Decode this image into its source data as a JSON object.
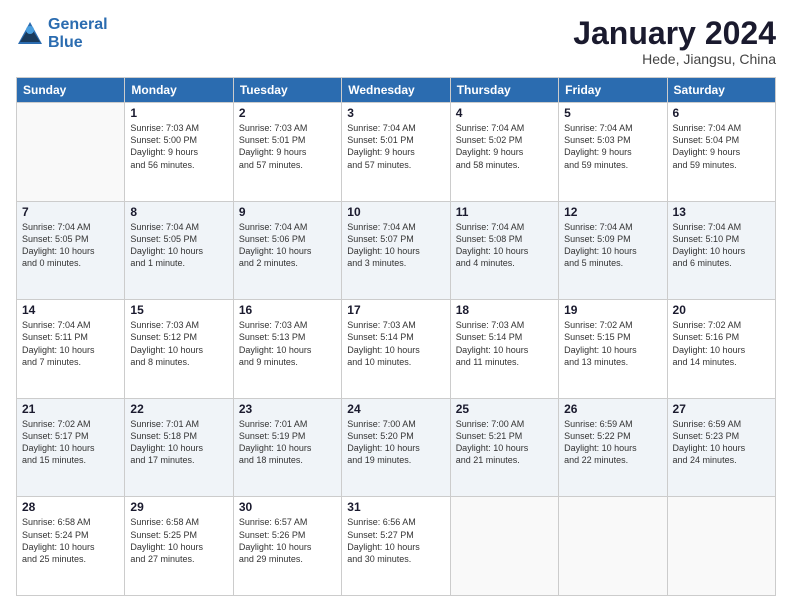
{
  "logo": {
    "line1": "General",
    "line2": "Blue"
  },
  "title": "January 2024",
  "location": "Hede, Jiangsu, China",
  "weekdays": [
    "Sunday",
    "Monday",
    "Tuesday",
    "Wednesday",
    "Thursday",
    "Friday",
    "Saturday"
  ],
  "weeks": [
    [
      {
        "day": "",
        "info": ""
      },
      {
        "day": "1",
        "info": "Sunrise: 7:03 AM\nSunset: 5:00 PM\nDaylight: 9 hours\nand 56 minutes."
      },
      {
        "day": "2",
        "info": "Sunrise: 7:03 AM\nSunset: 5:01 PM\nDaylight: 9 hours\nand 57 minutes."
      },
      {
        "day": "3",
        "info": "Sunrise: 7:04 AM\nSunset: 5:01 PM\nDaylight: 9 hours\nand 57 minutes."
      },
      {
        "day": "4",
        "info": "Sunrise: 7:04 AM\nSunset: 5:02 PM\nDaylight: 9 hours\nand 58 minutes."
      },
      {
        "day": "5",
        "info": "Sunrise: 7:04 AM\nSunset: 5:03 PM\nDaylight: 9 hours\nand 59 minutes."
      },
      {
        "day": "6",
        "info": "Sunrise: 7:04 AM\nSunset: 5:04 PM\nDaylight: 9 hours\nand 59 minutes."
      }
    ],
    [
      {
        "day": "7",
        "info": "Sunrise: 7:04 AM\nSunset: 5:05 PM\nDaylight: 10 hours\nand 0 minutes."
      },
      {
        "day": "8",
        "info": "Sunrise: 7:04 AM\nSunset: 5:05 PM\nDaylight: 10 hours\nand 1 minute."
      },
      {
        "day": "9",
        "info": "Sunrise: 7:04 AM\nSunset: 5:06 PM\nDaylight: 10 hours\nand 2 minutes."
      },
      {
        "day": "10",
        "info": "Sunrise: 7:04 AM\nSunset: 5:07 PM\nDaylight: 10 hours\nand 3 minutes."
      },
      {
        "day": "11",
        "info": "Sunrise: 7:04 AM\nSunset: 5:08 PM\nDaylight: 10 hours\nand 4 minutes."
      },
      {
        "day": "12",
        "info": "Sunrise: 7:04 AM\nSunset: 5:09 PM\nDaylight: 10 hours\nand 5 minutes."
      },
      {
        "day": "13",
        "info": "Sunrise: 7:04 AM\nSunset: 5:10 PM\nDaylight: 10 hours\nand 6 minutes."
      }
    ],
    [
      {
        "day": "14",
        "info": "Sunrise: 7:04 AM\nSunset: 5:11 PM\nDaylight: 10 hours\nand 7 minutes."
      },
      {
        "day": "15",
        "info": "Sunrise: 7:03 AM\nSunset: 5:12 PM\nDaylight: 10 hours\nand 8 minutes."
      },
      {
        "day": "16",
        "info": "Sunrise: 7:03 AM\nSunset: 5:13 PM\nDaylight: 10 hours\nand 9 minutes."
      },
      {
        "day": "17",
        "info": "Sunrise: 7:03 AM\nSunset: 5:14 PM\nDaylight: 10 hours\nand 10 minutes."
      },
      {
        "day": "18",
        "info": "Sunrise: 7:03 AM\nSunset: 5:14 PM\nDaylight: 10 hours\nand 11 minutes."
      },
      {
        "day": "19",
        "info": "Sunrise: 7:02 AM\nSunset: 5:15 PM\nDaylight: 10 hours\nand 13 minutes."
      },
      {
        "day": "20",
        "info": "Sunrise: 7:02 AM\nSunset: 5:16 PM\nDaylight: 10 hours\nand 14 minutes."
      }
    ],
    [
      {
        "day": "21",
        "info": "Sunrise: 7:02 AM\nSunset: 5:17 PM\nDaylight: 10 hours\nand 15 minutes."
      },
      {
        "day": "22",
        "info": "Sunrise: 7:01 AM\nSunset: 5:18 PM\nDaylight: 10 hours\nand 17 minutes."
      },
      {
        "day": "23",
        "info": "Sunrise: 7:01 AM\nSunset: 5:19 PM\nDaylight: 10 hours\nand 18 minutes."
      },
      {
        "day": "24",
        "info": "Sunrise: 7:00 AM\nSunset: 5:20 PM\nDaylight: 10 hours\nand 19 minutes."
      },
      {
        "day": "25",
        "info": "Sunrise: 7:00 AM\nSunset: 5:21 PM\nDaylight: 10 hours\nand 21 minutes."
      },
      {
        "day": "26",
        "info": "Sunrise: 6:59 AM\nSunset: 5:22 PM\nDaylight: 10 hours\nand 22 minutes."
      },
      {
        "day": "27",
        "info": "Sunrise: 6:59 AM\nSunset: 5:23 PM\nDaylight: 10 hours\nand 24 minutes."
      }
    ],
    [
      {
        "day": "28",
        "info": "Sunrise: 6:58 AM\nSunset: 5:24 PM\nDaylight: 10 hours\nand 25 minutes."
      },
      {
        "day": "29",
        "info": "Sunrise: 6:58 AM\nSunset: 5:25 PM\nDaylight: 10 hours\nand 27 minutes."
      },
      {
        "day": "30",
        "info": "Sunrise: 6:57 AM\nSunset: 5:26 PM\nDaylight: 10 hours\nand 29 minutes."
      },
      {
        "day": "31",
        "info": "Sunrise: 6:56 AM\nSunset: 5:27 PM\nDaylight: 10 hours\nand 30 minutes."
      },
      {
        "day": "",
        "info": ""
      },
      {
        "day": "",
        "info": ""
      },
      {
        "day": "",
        "info": ""
      }
    ]
  ]
}
